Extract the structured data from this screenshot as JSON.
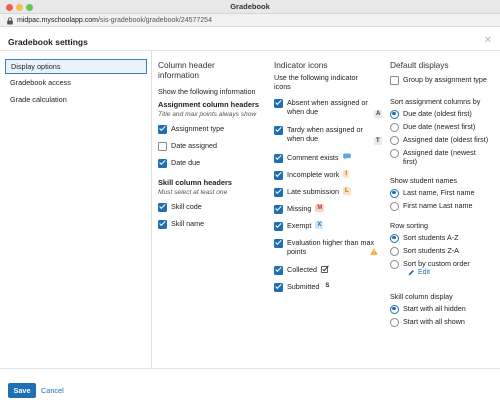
{
  "window": {
    "title": "Gradebook"
  },
  "browser": {
    "url_host": "midpac.myschoolapp.com",
    "url_path": "/sis-gradebook/gradebook/24577254"
  },
  "modal": {
    "title": "Gradebook settings",
    "close_icon": "close-icon",
    "save_label": "Save",
    "cancel_label": "Cancel"
  },
  "sidebar": {
    "items": [
      {
        "label": "Display options",
        "active": true
      },
      {
        "label": "Gradebook access",
        "active": false
      },
      {
        "label": "Grade calculation",
        "active": false
      }
    ]
  },
  "column_headers": {
    "heading_line1": "Column header",
    "heading_line2": "information",
    "subheading": "Show the following information",
    "assignment_title": "Assignment column headers",
    "assignment_note": "Title and max points always show",
    "assignment_options": [
      {
        "label": "Assignment type",
        "checked": true
      },
      {
        "label": "Date assigned",
        "checked": false
      },
      {
        "label": "Date due",
        "checked": true
      }
    ],
    "skill_title": "Skill column headers",
    "skill_note": "Must select at least one",
    "skill_options": [
      {
        "label": "Skill code",
        "checked": true
      },
      {
        "label": "Skill name",
        "checked": true
      }
    ]
  },
  "indicator_icons": {
    "heading": "Indicator icons",
    "subheading_line1": "Use the following indicator",
    "subheading_line2": "icons",
    "items": [
      {
        "label_line1": "Absent when assigned or",
        "label_line2": "when due",
        "badge": "A",
        "checked": true
      },
      {
        "label_line1": "Tardy when assigned or",
        "label_line2": "when due",
        "badge": "T",
        "checked": true
      },
      {
        "label_line1": "Comment exists",
        "icon": "speech-bubble-icon",
        "checked": true
      },
      {
        "label_line1": "Incomplete work",
        "badge": "I",
        "checked": true
      },
      {
        "label_line1": "Late submission",
        "badge": "L",
        "checked": true
      },
      {
        "label_line1": "Missing",
        "badge": "M",
        "checked": true
      },
      {
        "label_line1": "Exempt",
        "badge": "X",
        "checked": true
      },
      {
        "label_line1": "Evaluation higher than max",
        "label_line2": "points",
        "icon": "warning-triangle-icon",
        "checked": true
      },
      {
        "label_line1": "Collected",
        "icon": "collected-check-icon",
        "checked": true
      },
      {
        "label_line1": "Submitted",
        "badge": "S",
        "checked": true
      }
    ],
    "colors": {
      "orange": "#f5a623",
      "red": "#c0392b",
      "blue": "#1e6aa6"
    }
  },
  "default_displays": {
    "heading": "Default displays",
    "group_by_label": "Group by assignment type",
    "group_by_checked": false,
    "sort_title": "Sort assignment columns by",
    "sort_options": [
      {
        "label": "Due date (oldest first)",
        "selected": true
      },
      {
        "label": "Due date (newest first)",
        "selected": false
      },
      {
        "label": "Assigned date (oldest first)",
        "selected": false
      },
      {
        "label_line1": "Assigned date (newest",
        "label_line2": "first)",
        "selected": false
      }
    ],
    "names_title": "Show student names",
    "names_options": [
      {
        "label": "Last name, First name",
        "selected": true
      },
      {
        "label": "First name Last name",
        "selected": false
      }
    ],
    "row_title": "Row sorting",
    "row_options": [
      {
        "label": "Sort students A-Z",
        "selected": true
      },
      {
        "label": "Sort students Z-A",
        "selected": false
      },
      {
        "label": "Sort by custom order",
        "selected": false
      }
    ],
    "edit_label": "Edit",
    "skill_title": "Skill column display",
    "skill_options": [
      {
        "label": "Start with all hidden",
        "selected": true
      },
      {
        "label": "Start with all shown",
        "selected": false
      }
    ]
  },
  "accent_color": "#1f6fb5"
}
